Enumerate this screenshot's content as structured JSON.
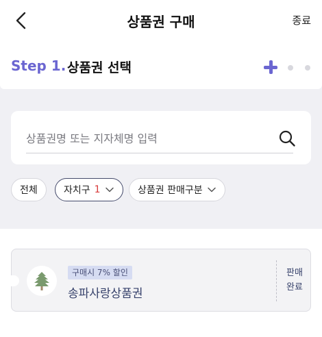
{
  "header": {
    "title": "상품권 구매",
    "close_label": "종료",
    "back_icon": "chevron-left-icon"
  },
  "step": {
    "label": "Step 1.",
    "title": "상품권 선택",
    "accent_color": "#6b66d1",
    "indicators": [
      "plus-icon",
      "dot",
      "dot"
    ]
  },
  "search": {
    "placeholder": "상품권명 또는 지자체명 입력",
    "value": "",
    "icon": "search-icon"
  },
  "filters": [
    {
      "label": "전체",
      "selected": false
    },
    {
      "label": "자치구",
      "count": "1",
      "selected": true,
      "dropdown": true
    },
    {
      "label": "상품권 판매구분",
      "selected": false,
      "dropdown": true
    }
  ],
  "vouchers": [
    {
      "badge": "구매시 7% 할인",
      "name": "송파사랑상품권",
      "status": "판매완료",
      "logo_icon": "pine-tree-icon"
    }
  ]
}
